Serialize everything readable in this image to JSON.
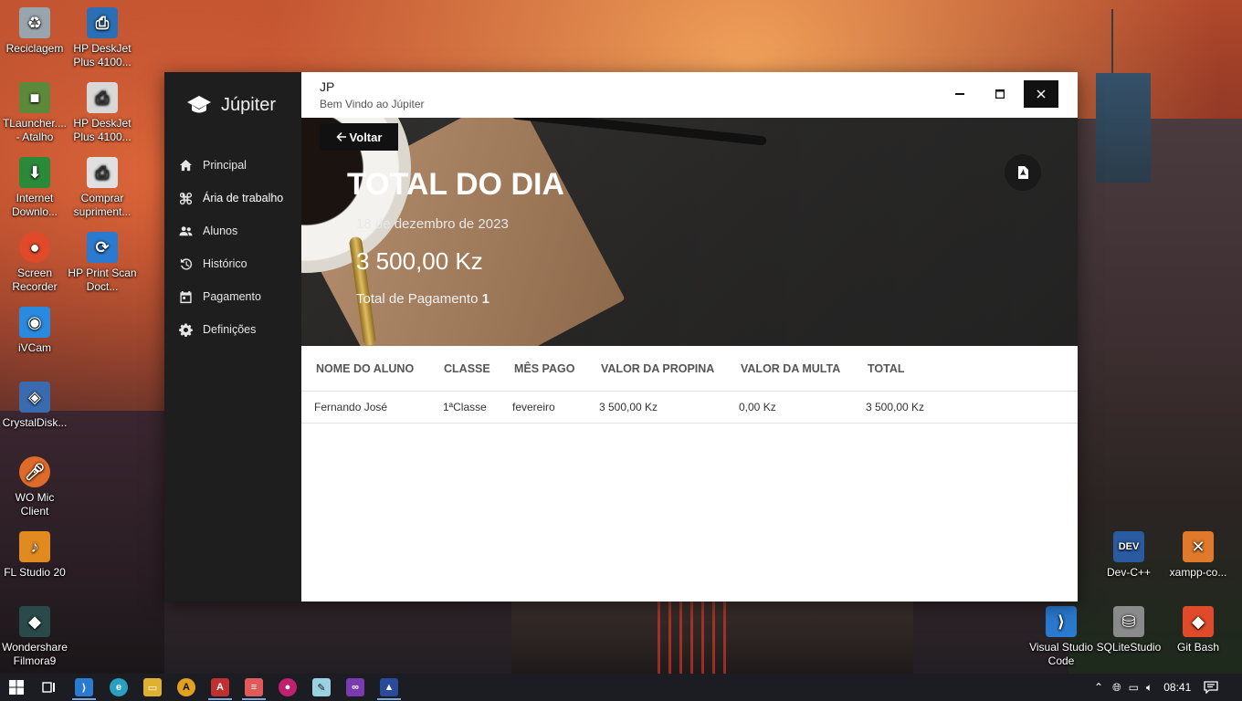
{
  "desktop_icons": [
    {
      "label": "Reciclagem",
      "icon": "recycle-bin-icon",
      "color": "#9aa4ad"
    },
    {
      "label": "HP DeskJet Plus 4100...",
      "icon": "printer-icon",
      "color": "#2a6fb5"
    },
    {
      "label": "TLauncher.... - Atalho",
      "icon": "minecraft-icon",
      "color": "#5c8a3a"
    },
    {
      "label": "HP DeskJet Plus 4100...",
      "icon": "printer-icon",
      "color": "#d8d8d8"
    },
    {
      "label": "Internet Downlo...",
      "icon": "download-manager-icon",
      "color": "#2a8a3a"
    },
    {
      "label": "Comprar supriment...",
      "icon": "printer-cart-icon",
      "color": "#e0e0e0"
    },
    {
      "label": "Screen Recorder",
      "icon": "record-icon",
      "color": "#e04a2a"
    },
    {
      "label": "HP Print Scan Doct...",
      "icon": "scan-icon",
      "color": "#2a7ad0"
    },
    {
      "label": "iVCam",
      "icon": "webcam-icon",
      "color": "#2a8ae0"
    },
    {
      "label": "CrystalDisk...",
      "icon": "disk-icon",
      "color": "#3a6ab0"
    },
    {
      "label": "WO Mic Client",
      "icon": "microphone-icon",
      "color": "#e06a2a"
    },
    {
      "label": "FL Studio 20",
      "icon": "fl-studio-icon",
      "color": "#e08a20"
    },
    {
      "label": "Wondershare Filmora9",
      "icon": "filmora-icon",
      "color": "#2a4a4a"
    },
    {
      "label": "Dev-C++",
      "icon": "devcpp-icon",
      "color": "#2a5aa0"
    },
    {
      "label": "xampp-co...",
      "icon": "xampp-icon",
      "color": "#e07a2a"
    },
    {
      "label": "Visual Studio Code",
      "icon": "vscode-icon",
      "color": "#2a7ad0"
    },
    {
      "label": "SQLiteStudio",
      "icon": "database-icon",
      "color": "#8a8a8a"
    },
    {
      "label": "Git Bash",
      "icon": "git-icon",
      "color": "#e04a2a"
    }
  ],
  "app": {
    "brand": "Júpiter",
    "title": "JP",
    "subtitle": "Bem Vindo ao  Júpiter",
    "nav": [
      {
        "label": "Principal",
        "icon": "home-icon"
      },
      {
        "label": "Ária de trabalho",
        "icon": "command-icon"
      },
      {
        "label": "Alunos",
        "icon": "people-icon"
      },
      {
        "label": "Histórico",
        "icon": "history-icon"
      },
      {
        "label": "Pagamento",
        "icon": "calendar-icon"
      },
      {
        "label": "Definições",
        "icon": "gear-icon"
      }
    ],
    "back_label": "Voltar",
    "hero": {
      "title": "TOTAL DO DIA",
      "date": "18 de dezembro de 2023",
      "amount": "3 500,00 Kz",
      "count_label": "Total de Pagamento",
      "count_value": "1"
    },
    "table": {
      "headers": [
        "NOME DO ALUNO",
        "CLASSE",
        "MÊS PAGO",
        "VALOR DA PROPINA",
        "VALOR DA MULTA",
        "TOTAL"
      ],
      "rows": [
        [
          "Fernando José",
          "1ªClasse",
          "fevereiro",
          "3 500,00 Kz",
          "0,00 Kz",
          "3 500,00 Kz"
        ]
      ]
    }
  },
  "taskbar": {
    "time": "08:41",
    "icons": [
      "windows-start-icon",
      "task-view-icon",
      "vscode-icon",
      "edge-icon",
      "file-explorer-icon",
      "autocad-icon",
      "access-icon",
      "layers-icon",
      "media-icon",
      "notepad-icon",
      "visual-studio-icon",
      "app-icon"
    ]
  }
}
